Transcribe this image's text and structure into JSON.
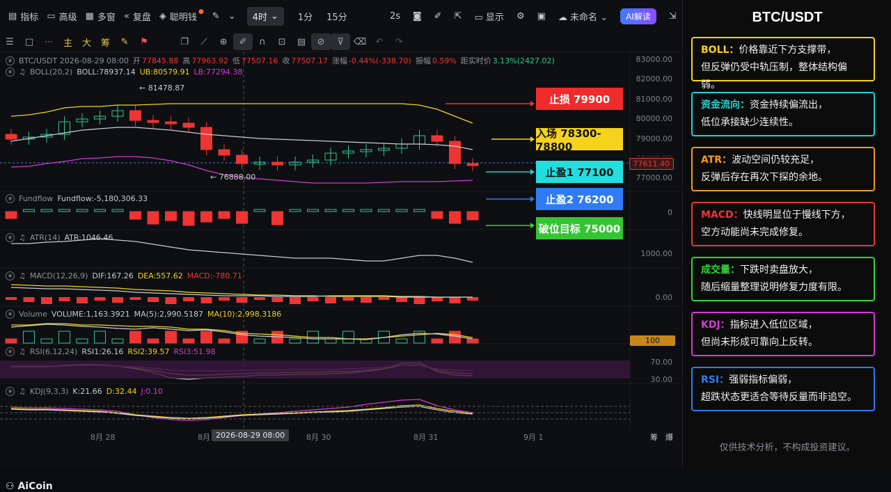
{
  "toolbar": {
    "indicators": "指标",
    "advanced": "高级",
    "multi_window": "多窗",
    "replay": "复盘",
    "smart_money": "聪明钱",
    "timeframe_active": "4时",
    "tf_1m": "1分",
    "tf_15m": "15分",
    "refresh": "2s",
    "display": "显示",
    "unnamed": "未命名",
    "ai_read": "AI解读"
  },
  "toolbar2": {
    "main": "主",
    "large": "大",
    "chips": "筹"
  },
  "chart": {
    "symbol_line": "BTC/USDT  2026-08-29 08:00",
    "open_label": "开",
    "open": "77845.88",
    "high_label": "高",
    "high": "77963.92",
    "low_label": "低",
    "low": "77507.16",
    "close_label": "收",
    "close": "77507.17",
    "change_label": "涨幅",
    "change": "-0.44%(-338.70)",
    "amp_label": "振幅",
    "amp": "0.59%",
    "dist_label": "距实时价",
    "dist": "3.13%(2427.02)",
    "boll_name": "BOLL(20,2)",
    "boll_val": "BOLL:78937.14",
    "boll_ub": "UB:80579.91",
    "boll_lb": "LB:77294.38",
    "high_mark": "← 81478.87",
    "low_mark": "← 76888.00",
    "price_axis": [
      "83000.00",
      "82000.00",
      "81000.00",
      "80000.00",
      "79000.00",
      "78000.00",
      "77000.00"
    ],
    "current_price": "77611.40",
    "fundflow_name": "Fundflow",
    "fundflow_val": "Fundflow:-5,180,306.33",
    "fundflow_axis": "0",
    "atr_name": "ATR(14)",
    "atr_val": "ATR:1046.46",
    "atr_axis": "1000.00",
    "macd_name": "MACD(12,26,9)",
    "macd_dif": "DIF:167.26",
    "macd_dea": "DEA:557.62",
    "macd_macd": "MACD:-780.71",
    "macd_axis": "0.00",
    "vol_name": "Volume",
    "vol_val": "VOLUME:1,163.3921",
    "vol_ma5": "MA(5):2,990.5187",
    "vol_ma10": "MA(10):2,998.3186",
    "vol_axis": "100",
    "rsi_name": "RSI(6,12,24)",
    "rsi1": "RSI1:26.16",
    "rsi2": "RSI2:39.57",
    "rsi3": "RSI3:51.98",
    "rsi_axis_hi": "70.00",
    "rsi_axis_lo": "30.00",
    "kdj_name": "KDJ(9,3,3)",
    "kdj_k": "K:21.66",
    "kdj_d": "D:32.44",
    "kdj_j": "J:0.10",
    "dates": [
      "8月 28",
      "8月",
      "8月 30",
      "8月 31",
      "9月 1"
    ],
    "date_highlight": "2026-08-29 08:00",
    "corner_left": "筹",
    "corner_right": "爆",
    "logo": "AiCoin"
  },
  "signals": {
    "stop_loss": "止损 79900",
    "entry": "入场 78300-78800",
    "tp1": "止盈1 77100",
    "tp2": "止盈2 76200",
    "break_target": "破位目标 75000"
  },
  "panel": {
    "title": "BTC/USDT",
    "cards": [
      {
        "key": "BOLL：",
        "l1": "价格靠近下方支撑带，",
        "l2": "但反弹仍受中轨压制，整体结构偏弱。",
        "color": "#f5d31c"
      },
      {
        "key": "资金流向：",
        "l1": "资金持续偏流出，",
        "l2": "低位承接缺少连续性。",
        "color": "#22d3d3"
      },
      {
        "key": "ATR：",
        "l1": "波动空间仍较充足，",
        "l2": "反弹后存在再次下探的余地。",
        "color": "#f59a1c"
      },
      {
        "key": "MACD：",
        "l1": "快线明显位于慢线下方，",
        "l2": "空方动能尚未完成修复。",
        "color": "#ef3434"
      },
      {
        "key": "成交量：",
        "l1": "下跌时卖盘放大，",
        "l2": "随后缩量整理说明修复力度有限。",
        "color": "#34d534"
      },
      {
        "key": "KDJ：",
        "l1": "指标进入低位区域，",
        "l2": "但尚未形成可靠向上反转。",
        "color": "#d23bd2"
      },
      {
        "key": "RSI：",
        "l1": "强弱指标偏弱，",
        "l2": "超跌状态更适合等待反量而非追空。",
        "color": "#2f7bf5"
      }
    ],
    "footer": "仅供技术分析，不构成投资建议。"
  }
}
